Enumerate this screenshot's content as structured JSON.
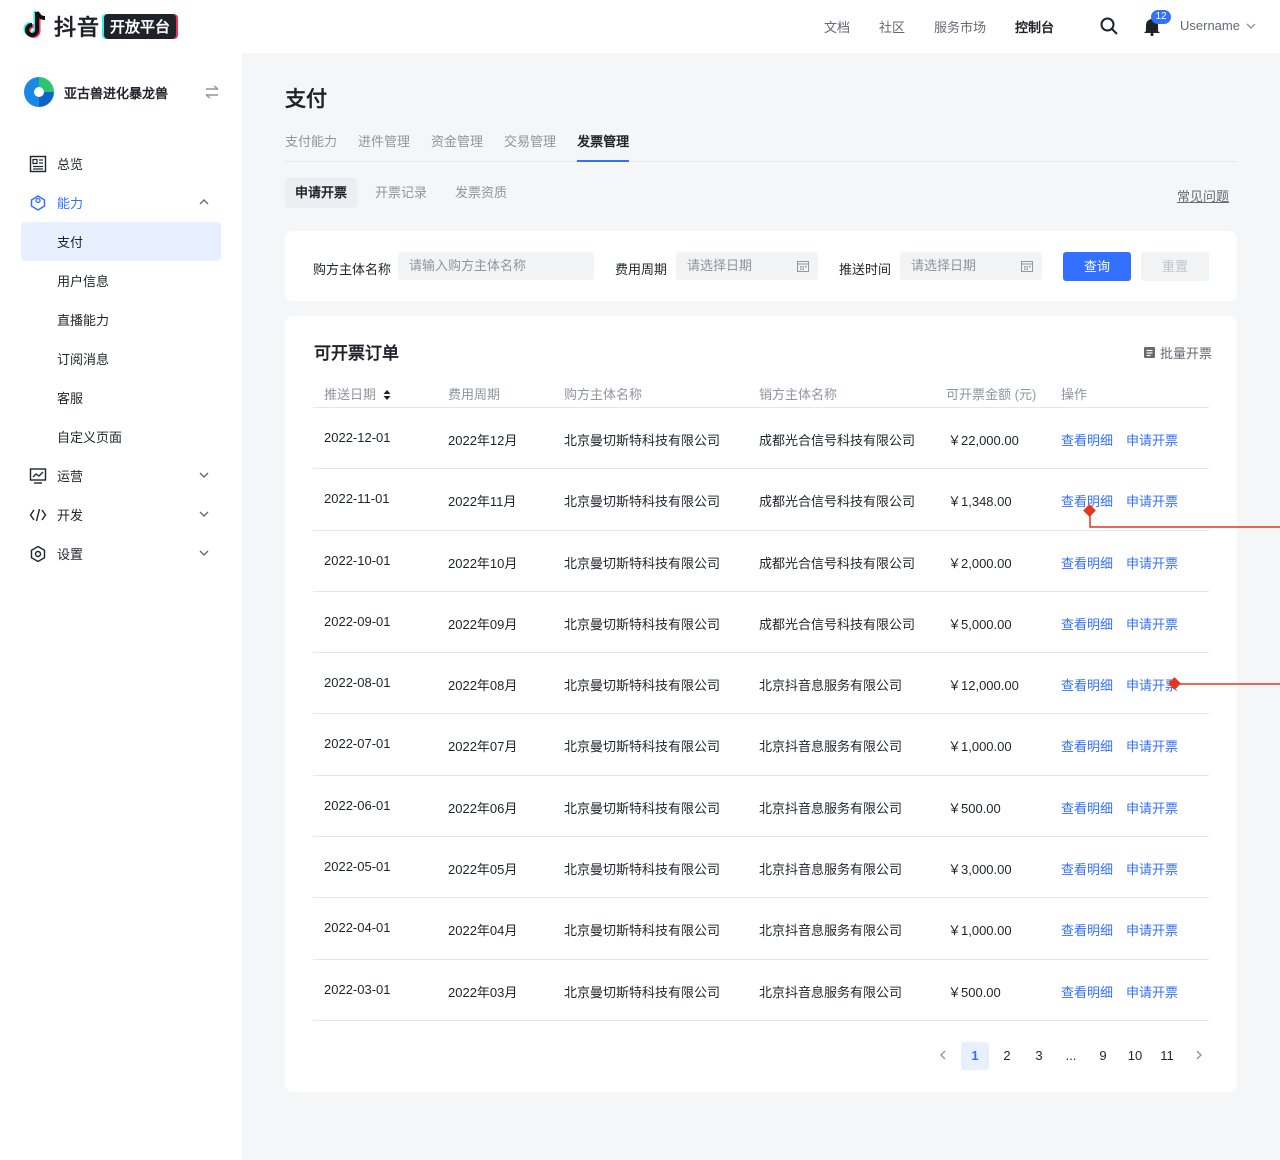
{
  "header": {
    "brand": "抖音",
    "badge": "开放平台",
    "nav": [
      "文档",
      "社区",
      "服务市场",
      "控制台"
    ],
    "active_nav": "控制台",
    "notifications": "12",
    "username": "Username"
  },
  "sidebar": {
    "app_name": "亚古兽进化暴龙兽",
    "menu": {
      "overview": "总览",
      "ability": "能力",
      "ability_sub": [
        "支付",
        "用户信息",
        "直播能力",
        "订阅消息",
        "客服",
        "自定义页面"
      ],
      "operation": "运营",
      "develop": "开发",
      "settings": "设置"
    }
  },
  "page": {
    "title": "支付",
    "tabs": [
      "支付能力",
      "进件管理",
      "资金管理",
      "交易管理",
      "发票管理"
    ],
    "subtabs": [
      "申请开票",
      "开票记录",
      "发票资质"
    ],
    "faq": "常见问题"
  },
  "filter": {
    "buyer_label": "购方主体名称",
    "buyer_placeholder": "请输入购方主体名称",
    "period_label": "费用周期",
    "period_placeholder": "请选择日期",
    "push_label": "推送时间",
    "push_placeholder": "请选择日期",
    "query": "查询",
    "reset": "重置"
  },
  "table": {
    "title": "可开票订单",
    "batch": "批量开票",
    "columns": [
      "推送日期",
      "费用周期",
      "购方主体名称",
      "销方主体名称",
      "可开票金额 (元)",
      "操作"
    ],
    "rows": [
      [
        "2022-12-01",
        "2022年12月",
        "北京曼切斯特科技有限公司",
        "成都光合信号科技有限公司",
        "￥22,000.00",
        "查看明细",
        "申请开票"
      ],
      [
        "2022-11-01",
        "2022年11月",
        "北京曼切斯特科技有限公司",
        "成都光合信号科技有限公司",
        "￥1,348.00",
        "查看明细",
        "申请开票"
      ],
      [
        "2022-10-01",
        "2022年10月",
        "北京曼切斯特科技有限公司",
        "成都光合信号科技有限公司",
        "￥2,000.00",
        "查看明细",
        "申请开票"
      ],
      [
        "2022-09-01",
        "2022年09月",
        "北京曼切斯特科技有限公司",
        "成都光合信号科技有限公司",
        "￥5,000.00",
        "查看明细",
        "申请开票"
      ],
      [
        "2022-08-01",
        "2022年08月",
        "北京曼切斯特科技有限公司",
        "北京抖音息服务有限公司",
        "￥12,000.00",
        "查看明细",
        "申请开票"
      ],
      [
        "2022-07-01",
        "2022年07月",
        "北京曼切斯特科技有限公司",
        "北京抖音息服务有限公司",
        "￥1,000.00",
        "查看明细",
        "申请开票"
      ],
      [
        "2022-06-01",
        "2022年06月",
        "北京曼切斯特科技有限公司",
        "北京抖音息服务有限公司",
        "￥500.00",
        "查看明细",
        "申请开票"
      ],
      [
        "2022-05-01",
        "2022年05月",
        "北京曼切斯特科技有限公司",
        "北京抖音息服务有限公司",
        "￥3,000.00",
        "查看明细",
        "申请开票"
      ],
      [
        "2022-04-01",
        "2022年04月",
        "北京曼切斯特科技有限公司",
        "北京抖音息服务有限公司",
        "￥1,000.00",
        "查看明细",
        "申请开票"
      ],
      [
        "2022-03-01",
        "2022年03月",
        "北京曼切斯特科技有限公司",
        "北京抖音息服务有限公司",
        "￥500.00",
        "查看明细",
        "申请开票"
      ]
    ]
  },
  "pagination": {
    "pages": [
      "1",
      "2",
      "3",
      "...",
      "9",
      "10",
      "11"
    ],
    "current": "1"
  },
  "colors": {
    "accent": "#3370ff",
    "annotation": "#e8341c"
  },
  "icons": [
    "douyin-logo-icon",
    "search-icon",
    "bell-icon",
    "chevron-down-icon",
    "switch-icon",
    "overview-icon",
    "ability-icon",
    "operation-icon",
    "code-icon",
    "settings-icon",
    "calendar-icon",
    "batch-icon",
    "sort-icon"
  ]
}
